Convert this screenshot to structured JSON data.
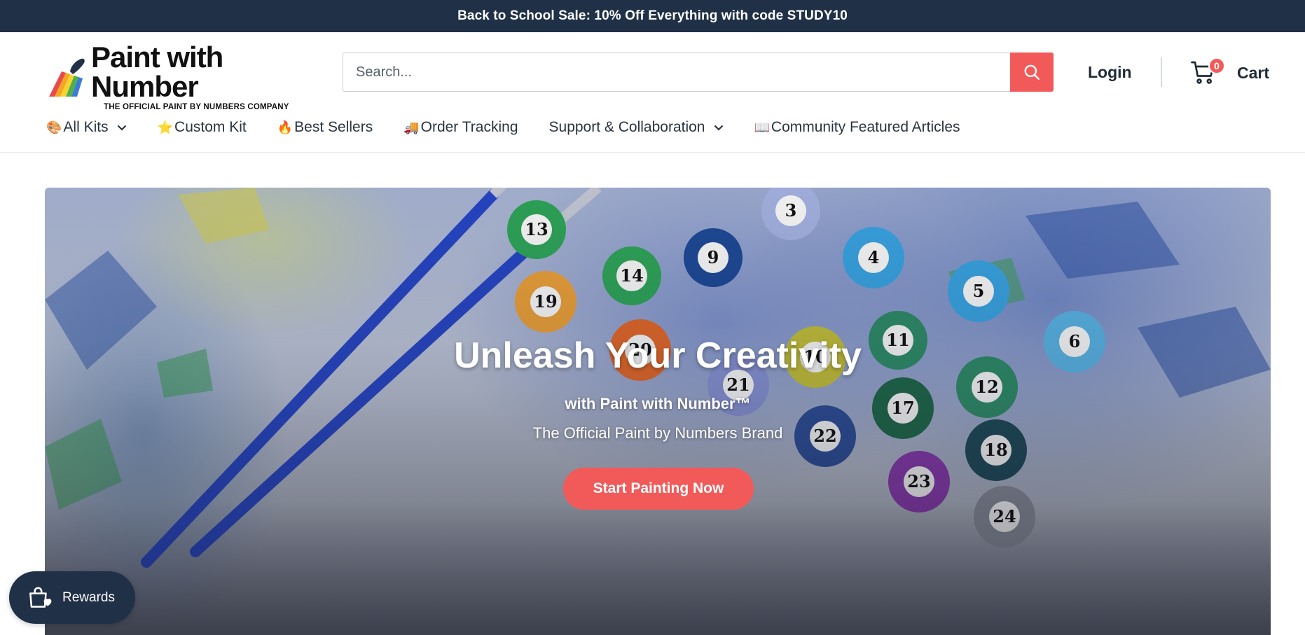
{
  "announcement": {
    "text": "Back to School Sale: 10% Off Everything with code STUDY10"
  },
  "brand": {
    "name": "Paint with Number",
    "tagline": "THE OFFICIAL PAINT BY NUMBERS COMPANY",
    "accent_color": "#f25a5a",
    "dark_color": "#1f3047"
  },
  "search": {
    "placeholder": "Search...",
    "value": "",
    "icon": "search-icon"
  },
  "account": {
    "login_label": "Login"
  },
  "cart": {
    "count": "0",
    "label": "Cart",
    "icon": "cart-icon"
  },
  "nav": {
    "items": [
      {
        "emoji": "🎨",
        "label": "All Kits",
        "dropdown": true
      },
      {
        "emoji": "⭐",
        "label": "Custom Kit",
        "dropdown": false
      },
      {
        "emoji": "🔥",
        "label": "Best Sellers",
        "dropdown": false
      },
      {
        "emoji": "🚚",
        "label": "Order Tracking",
        "dropdown": false
      },
      {
        "emoji": "",
        "label": "Support & Collaboration",
        "dropdown": true
      },
      {
        "emoji": "📖",
        "label": "Community Featured Articles",
        "dropdown": false
      }
    ]
  },
  "hero": {
    "title": "Unleash Your Creativity",
    "subtitle_line1": "with Paint with Number™",
    "subtitle_line2": "The Official Paint by Numbers Brand",
    "cta_label": "Start Painting Now",
    "paint_pot_numbers": [
      "13",
      "3",
      "9",
      "14",
      "4",
      "19",
      "5",
      "11",
      "6",
      "20",
      "10",
      "12",
      "17",
      "22",
      "18",
      "23",
      "24",
      "21"
    ]
  },
  "rewards": {
    "label": "Rewards",
    "icon": "shopping-bag-heart-icon"
  }
}
